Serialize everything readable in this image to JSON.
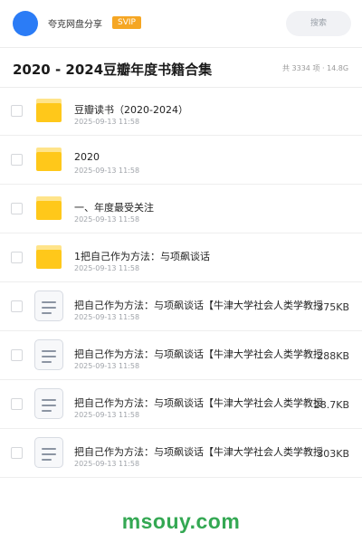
{
  "header": {
    "owner_name": "夸克网盘分享",
    "badge": "SVIP",
    "search_placeholder": "搜索",
    "accent_color": "#2b7cf6",
    "badge_color": "#f5a623"
  },
  "share": {
    "title": "2020 - 2024豆瓣年度书籍合集",
    "summary": "共 3334 项 · 14.8G"
  },
  "items": [
    {
      "type": "folder",
      "icon": "folder-icon",
      "name": "豆瓣读书（2020-2024）",
      "date": "2025-09-13 11:58",
      "size": ""
    },
    {
      "type": "folder",
      "icon": "folder-icon",
      "name": "2020",
      "date": "2025-09-13 11:58",
      "size": ""
    },
    {
      "type": "folder",
      "icon": "folder-icon",
      "name": "一、年度最受关注",
      "date": "2025-09-13 11:58",
      "size": ""
    },
    {
      "type": "folder",
      "icon": "folder-icon",
      "name": "1把自己作为方法：与项飙谈话",
      "date": "2025-09-13 11:58",
      "size": ""
    },
    {
      "type": "file",
      "icon": "document-icon",
      "name": "把自己作为方法：与项飙谈话【牛津大学社会人类学教授",
      "date": "2025-09-13 11:58",
      "size": "375KB"
    },
    {
      "type": "file",
      "icon": "document-icon",
      "name": "把自己作为方法：与项飙谈话【牛津大学社会人类学教授",
      "date": "2025-09-13 11:58",
      "size": "288KB"
    },
    {
      "type": "file",
      "icon": "document-icon",
      "name": "把自己作为方法：与项飙谈话【牛津大学社会人类学教授",
      "date": "2025-09-13 11:58",
      "size": "28.7KB"
    },
    {
      "type": "file",
      "icon": "document-icon",
      "name": "把自己作为方法：与项飙谈话【牛津大学社会人类学教授",
      "date": "2025-09-13 11:58",
      "size": "303KB"
    }
  ],
  "watermark": {
    "text": "msouy.com",
    "color": "#34a853"
  }
}
